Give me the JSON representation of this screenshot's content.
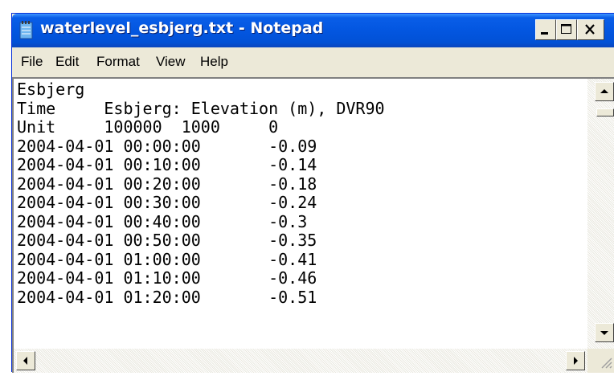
{
  "window": {
    "title": "waterlevel_esbjerg.txt - Notepad",
    "icon": "notepad-icon",
    "controls": [
      "minimize-icon",
      "maximize-icon",
      "close-icon"
    ]
  },
  "menu": {
    "items": [
      "File",
      "Edit",
      "Format",
      "View",
      "Help"
    ]
  },
  "document": {
    "lines": [
      "Esbjerg",
      "Time     Esbjerg: Elevation (m), DVR90",
      "Unit     100000  1000     0",
      "2004-04-01 00:00:00       -0.09",
      "2004-04-01 00:10:00       -0.14",
      "2004-04-01 00:20:00       -0.18",
      "2004-04-01 00:30:00       -0.24",
      "2004-04-01 00:40:00       -0.3",
      "2004-04-01 00:50:00       -0.35",
      "2004-04-01 01:00:00       -0.41",
      "2004-04-01 01:10:00       -0.46",
      "2004-04-01 01:20:00       -0.51"
    ]
  },
  "colors": {
    "titlebar": "#0356e0",
    "chrome": "#ece9d8",
    "editor_bg": "#ffffff"
  }
}
